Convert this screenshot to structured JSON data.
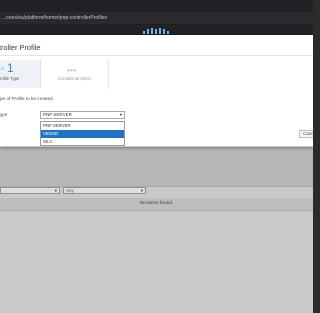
{
  "browser": {
    "url": "...coes/eu/platform/home#pnp-controllerProfiles"
  },
  "colors": {
    "app_header": "#1f2227",
    "logo": "#79aee6",
    "accent": "#2f8be6",
    "selected_option": "#1f74c7"
  },
  "icons": {
    "logo": "cisco-logo-icon",
    "select_chevron": "chevron-down-icon"
  },
  "modal": {
    "title": "troller Profile",
    "steps": [
      {
        "prefix": "o",
        "number": "1",
        "label": "rofile Type"
      },
      {
        "dots": "•••",
        "label": "Conditional Steps"
      }
    ],
    "instruction": "pe of Profile to be created.",
    "field_label": "ype",
    "selected_value": "PNP SERVER",
    "options": [
      "PNP SERVER",
      "VBOND",
      "WLC"
    ],
    "highlighted_option_index": 1,
    "cancel_label": "Canc"
  },
  "background": {
    "filter_left_value": "",
    "filter_right_value": "Any",
    "empty_message": "No items found."
  }
}
